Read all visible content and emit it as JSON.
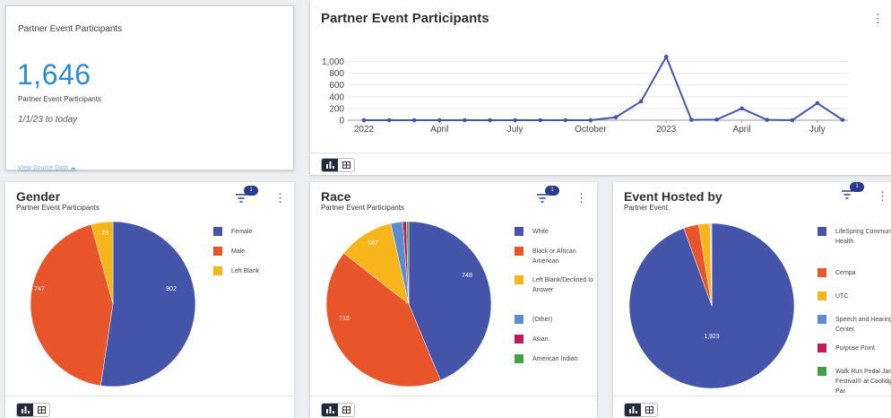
{
  "kpi": {
    "title": "Partner Event Participants",
    "value": "1,646",
    "subtitle": "Partner Event Participants",
    "range": "1/1/23 to today",
    "source_link": "View Source Data"
  },
  "colors": {
    "blue": "#4454a8",
    "orange": "#e8552a",
    "yellow": "#f6b51b",
    "steel": "#5b8ccf",
    "crimson": "#c2185b",
    "green": "#43a047",
    "kpi_blue": "#2d8bd0"
  },
  "chart_data": [
    {
      "type": "line",
      "title": "Partner Event Participants",
      "x": [
        "2022-01",
        "2022-02",
        "2022-03",
        "2022-04",
        "2022-05",
        "2022-06",
        "2022-07",
        "2022-08",
        "2022-09",
        "2022-10",
        "2022-11",
        "2022-12",
        "2023-01",
        "2023-02",
        "2023-03",
        "2023-04",
        "2023-05",
        "2023-06",
        "2023-07",
        "2023-08"
      ],
      "values": [
        0,
        0,
        0,
        0,
        0,
        0,
        0,
        0,
        0,
        0,
        50,
        320,
        1080,
        5,
        10,
        200,
        5,
        0,
        290,
        5
      ],
      "x_tick_labels": [
        "2022",
        "April",
        "July",
        "October",
        "2023",
        "April",
        "July"
      ],
      "y_ticks": [
        "0",
        "200",
        "400",
        "600",
        "800",
        "1,000"
      ],
      "ylim": [
        0,
        1100
      ],
      "grid": true,
      "color": "#4454a8"
    },
    {
      "type": "pie",
      "title": "Gender",
      "subtitle": "Partner Event Participants",
      "filter_count": "1",
      "slices": [
        {
          "label": "Female",
          "value": 902,
          "color": "#4454a8"
        },
        {
          "label": "Male",
          "value": 747,
          "color": "#e8552a"
        },
        {
          "label": "Left Blank",
          "value": 73,
          "color": "#f6b51b"
        }
      ]
    },
    {
      "type": "pie",
      "title": "Race",
      "subtitle": "Partner Event Participants",
      "filter_count": "1",
      "slices": [
        {
          "label": "White",
          "value": 748,
          "color": "#4454a8"
        },
        {
          "label": "Black or African American",
          "value": 716,
          "color": "#e8552a"
        },
        {
          "label": "Left Blank/Declined to Answer",
          "value": 187,
          "color": "#f6b51b"
        },
        {
          "label": "(Other)",
          "value": 40,
          "color": "#5b8ccf"
        },
        {
          "label": "Asian",
          "value": 12,
          "color": "#c2185b"
        },
        {
          "label": "American Indian",
          "value": 8,
          "color": "#43a047"
        }
      ]
    },
    {
      "type": "pie",
      "title": "Event Hosted by",
      "subtitle": "Partner Event",
      "filter_count": "1",
      "slices": [
        {
          "label": "LifeSpring Community Health",
          "value": 1923,
          "color": "#4454a8"
        },
        {
          "label": "Cempa",
          "value": 60,
          "color": "#e8552a"
        },
        {
          "label": "UTC",
          "value": 45,
          "color": "#f6b51b"
        },
        {
          "label": "Speech and Hearing Center",
          "value": 3,
          "color": "#5b8ccf"
        },
        {
          "label": "Purpose Point",
          "value": 2,
          "color": "#c2185b"
        },
        {
          "label": "Walk Run Pedal Jamz Festival® at Coolidge Par",
          "value": 2,
          "color": "#43a047"
        }
      ]
    }
  ]
}
